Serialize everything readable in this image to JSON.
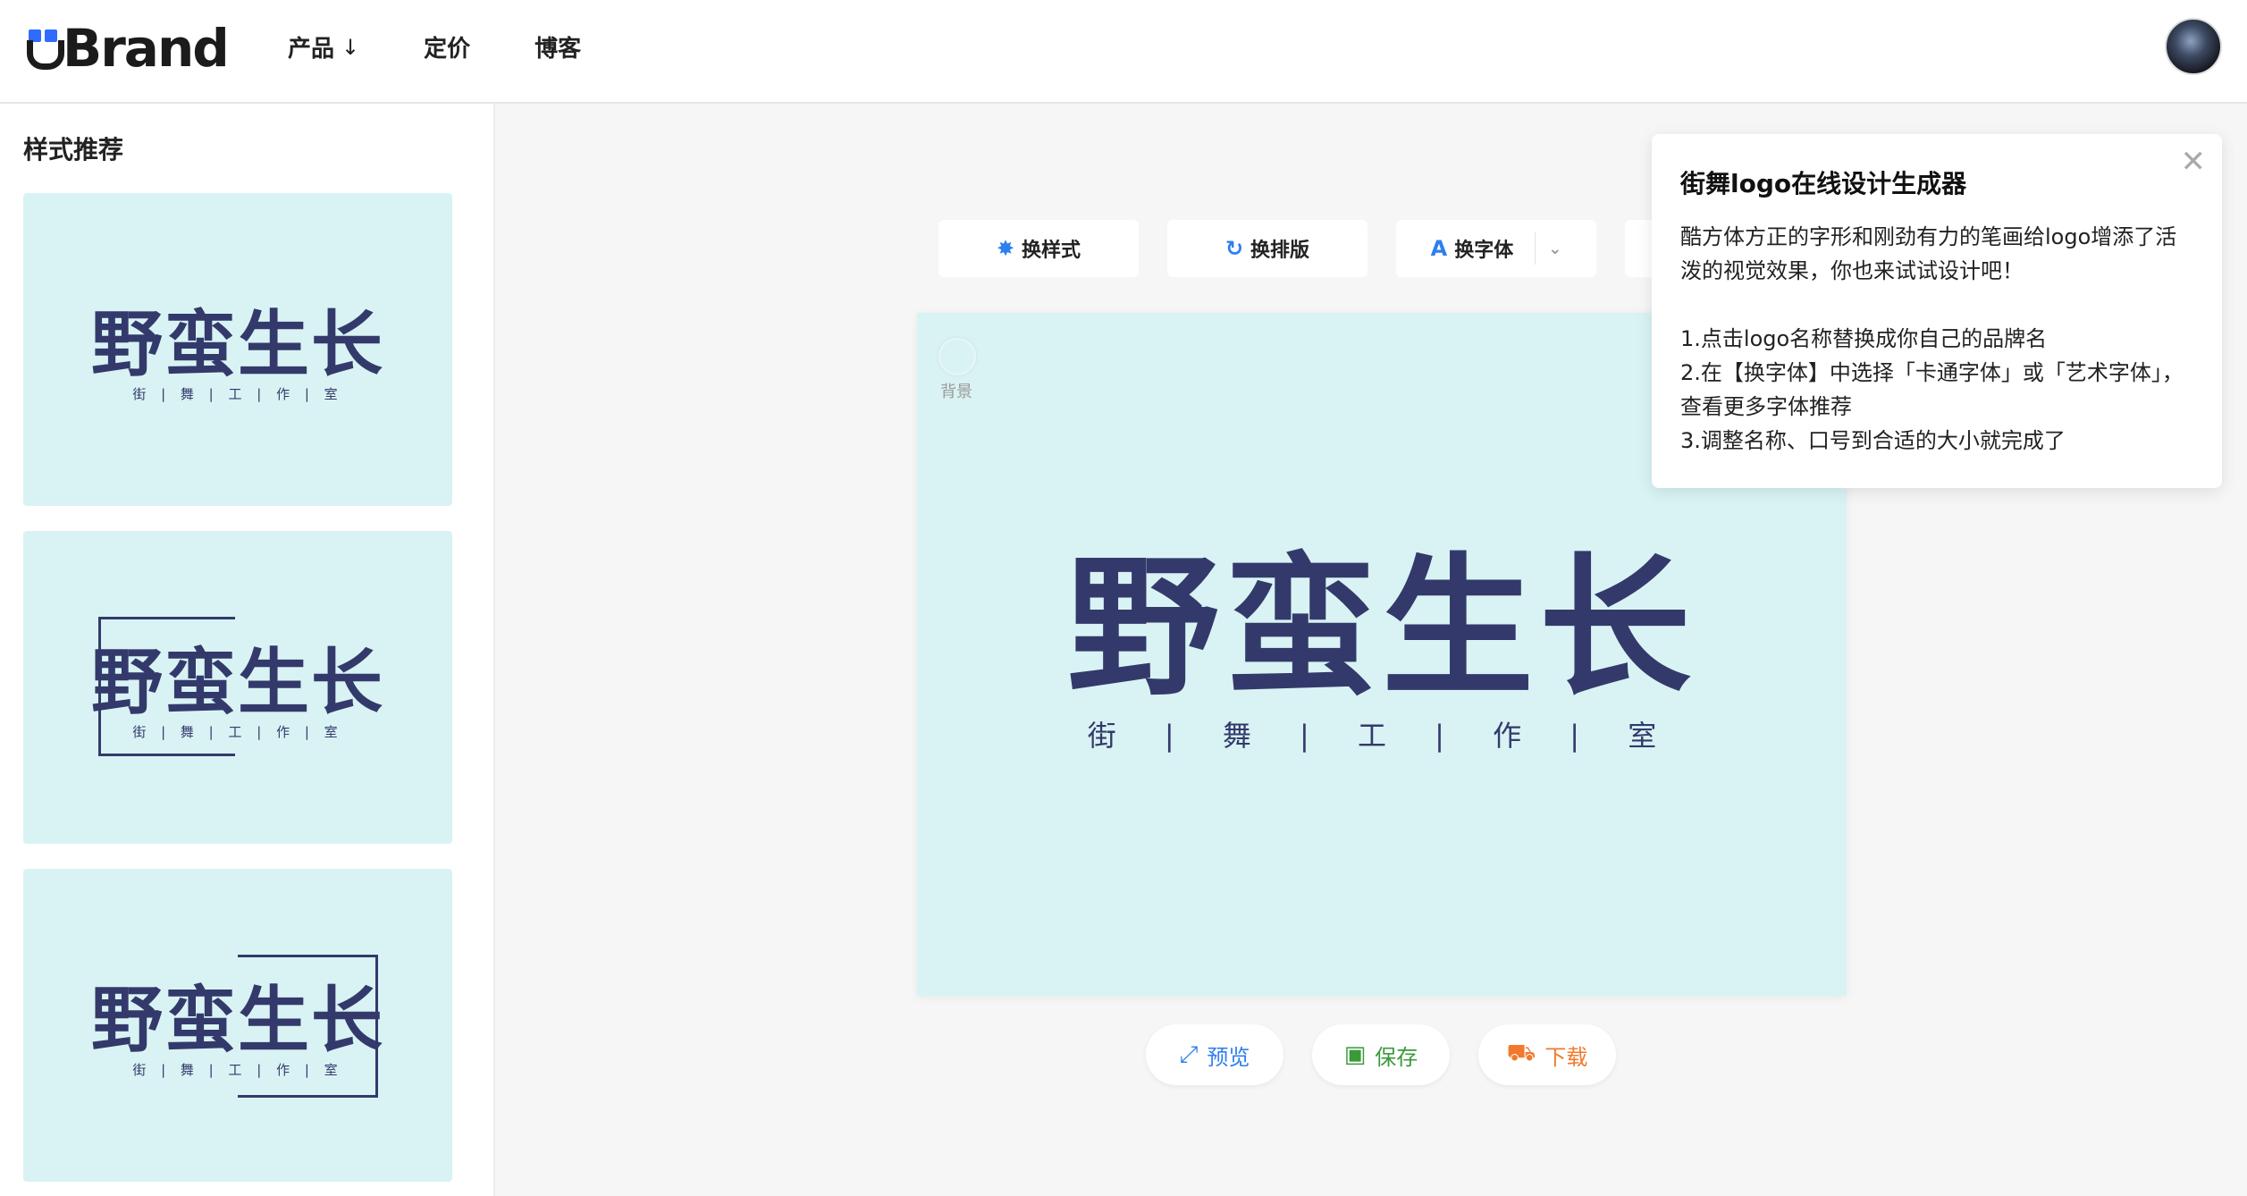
{
  "header": {
    "logo_text": "Brand",
    "nav": [
      {
        "label": "产品",
        "arrow": "↓"
      },
      {
        "label": "定价"
      },
      {
        "label": "博客"
      }
    ]
  },
  "sidebar": {
    "title": "样式推荐",
    "thumbs": [
      {
        "brand": "野蛮生长",
        "slogan": "街 | 舞 | 工 | 作 | 室"
      },
      {
        "brand": "野蛮生长",
        "slogan": "街 | 舞 | 工 | 作 | 室"
      },
      {
        "brand": "野蛮生长",
        "slogan": "街 | 舞 | 工 | 作 | 室"
      }
    ]
  },
  "toolbar": {
    "change_style": "换样式",
    "change_layout": "换排版",
    "change_font": "换字体"
  },
  "canvas": {
    "bg_label": "背景",
    "brand": "野蛮生长",
    "slogan": "街 | 舞 | 工 | 作 | 室",
    "bg_color": "#d9f3f4",
    "text_color": "#333a6b"
  },
  "actions": {
    "preview": "预览",
    "save": "保存",
    "download": "下载"
  },
  "tip": {
    "title": "街舞logo在线设计生成器",
    "intro": "酷方体方正的字形和刚劲有力的笔画给logo增添了活泼的视觉效果，你也来试试设计吧！",
    "step1": "1.点击logo名称替换成你自己的品牌名",
    "step2": "2.在【换字体】中选择「卡通字体」或「艺术字体」，查看更多字体推荐",
    "step3": "3.调整名称、口号到合适的大小就完成了"
  },
  "colors": {
    "accent_blue": "#2e7ff0",
    "save_green": "#3a9a3a",
    "download_orange": "#f07a2e"
  }
}
